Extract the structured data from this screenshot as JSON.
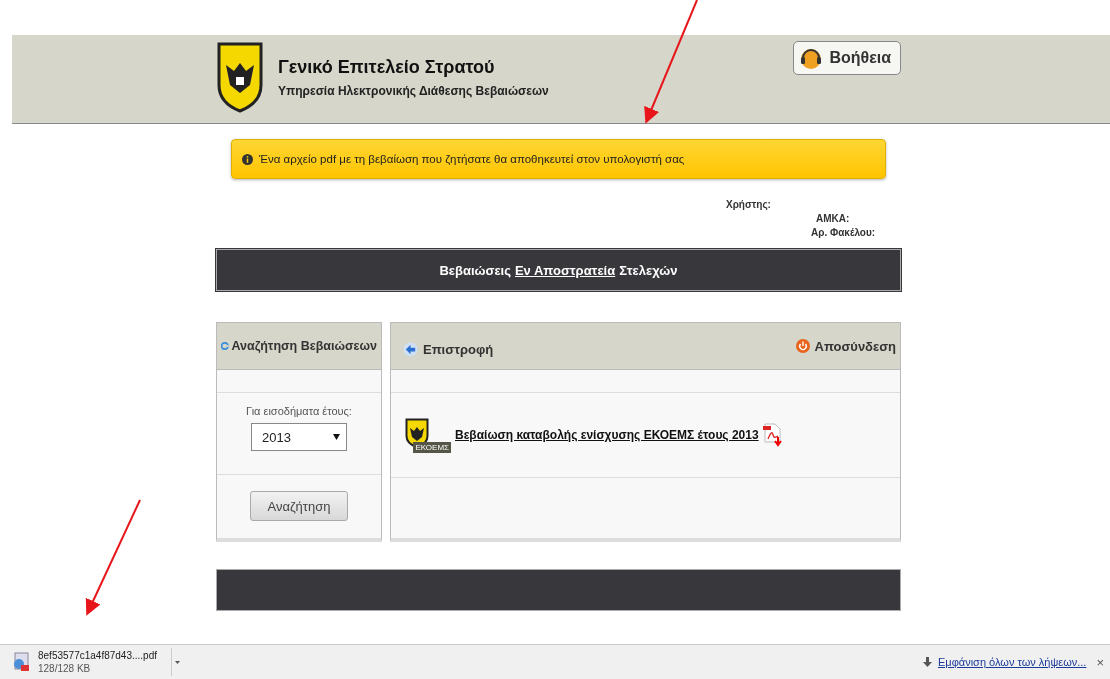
{
  "header": {
    "title": "Γενικό Επιτελείο Στρατού",
    "subtitle": "Υπηρεσία Ηλεκτρονικής Διάθεσης Βεβαιώσεων",
    "help_button": "Βοήθεια"
  },
  "alert": {
    "text": "Ένα αρχείο pdf με τη βεβαίωση που ζητήσατε θα αποθηκευτεί στον υπολογιστή σας"
  },
  "user_info": [
    {
      "label": "Χρήστης:"
    },
    {
      "label": "ΑΜΚΑ:"
    },
    {
      "label": "Αρ. Φακέλου:"
    }
  ],
  "banner": {
    "prefix": "Βεβαιώσεις",
    "link": "Εν Αποστρατεία",
    "suffix": "Στελεχών"
  },
  "search_panel": {
    "title": "Αναζήτηση Βεβαιώσεων",
    "year_label": "Για εισοδήματα έτους:",
    "year_value": "2013",
    "search_button": "Αναζήτηση"
  },
  "results_panel": {
    "back": "Επιστροφή",
    "logout": "Αποσύνδεση",
    "documents": [
      {
        "badge": "ΕΚΟΕΜΣ",
        "link": "Βεβαίωση καταβολής ενίσχυσης ΕΚΟΕΜΣ έτους 2013"
      }
    ]
  },
  "download_bar": {
    "file_name": "8ef53577c1a4f87d43....pdf",
    "size": "128/128 KB",
    "show_all": "Εμφάνιση όλων των λήψεων...",
    "close": "×"
  }
}
